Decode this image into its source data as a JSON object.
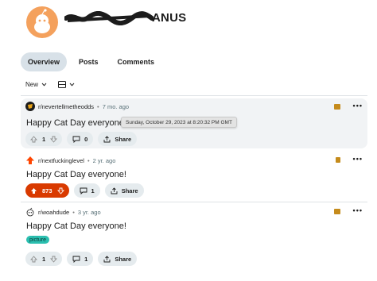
{
  "profile": {
    "username": "ANUS"
  },
  "tabs": [
    {
      "label": "Overview",
      "active": true
    },
    {
      "label": "Posts",
      "active": false
    },
    {
      "label": "Comments",
      "active": false
    }
  ],
  "sort": {
    "label": "New"
  },
  "posts": [
    {
      "subreddit": "r/nevertellmetheodds",
      "age": "7 mo. ago",
      "title": "Happy Cat Day everyone!",
      "tooltip": "Sunday, October 29, 2023 at 8:20:32 PM GMT",
      "votes": "1",
      "comments": "0",
      "share_label": "Share"
    },
    {
      "subreddit": "r/nextfuckinglevel",
      "age": "2 yr. ago",
      "title": "Happy Cat Day everyone!",
      "votes": "873",
      "comments": "1",
      "share_label": "Share"
    },
    {
      "subreddit": "r/woahdude",
      "age": "3 yr. ago",
      "title": "Happy Cat Day everyone!",
      "flair": "picture",
      "votes": "1",
      "comments": "1",
      "share_label": "Share"
    }
  ],
  "separator": "•",
  "more_glyph": "•••",
  "colors": {
    "accent_upvote": "#d93a00",
    "tab_active_bg": "#d8e1e8",
    "flair_bg": "#2bbfb0",
    "avatar_bg": "#f4a15d"
  }
}
